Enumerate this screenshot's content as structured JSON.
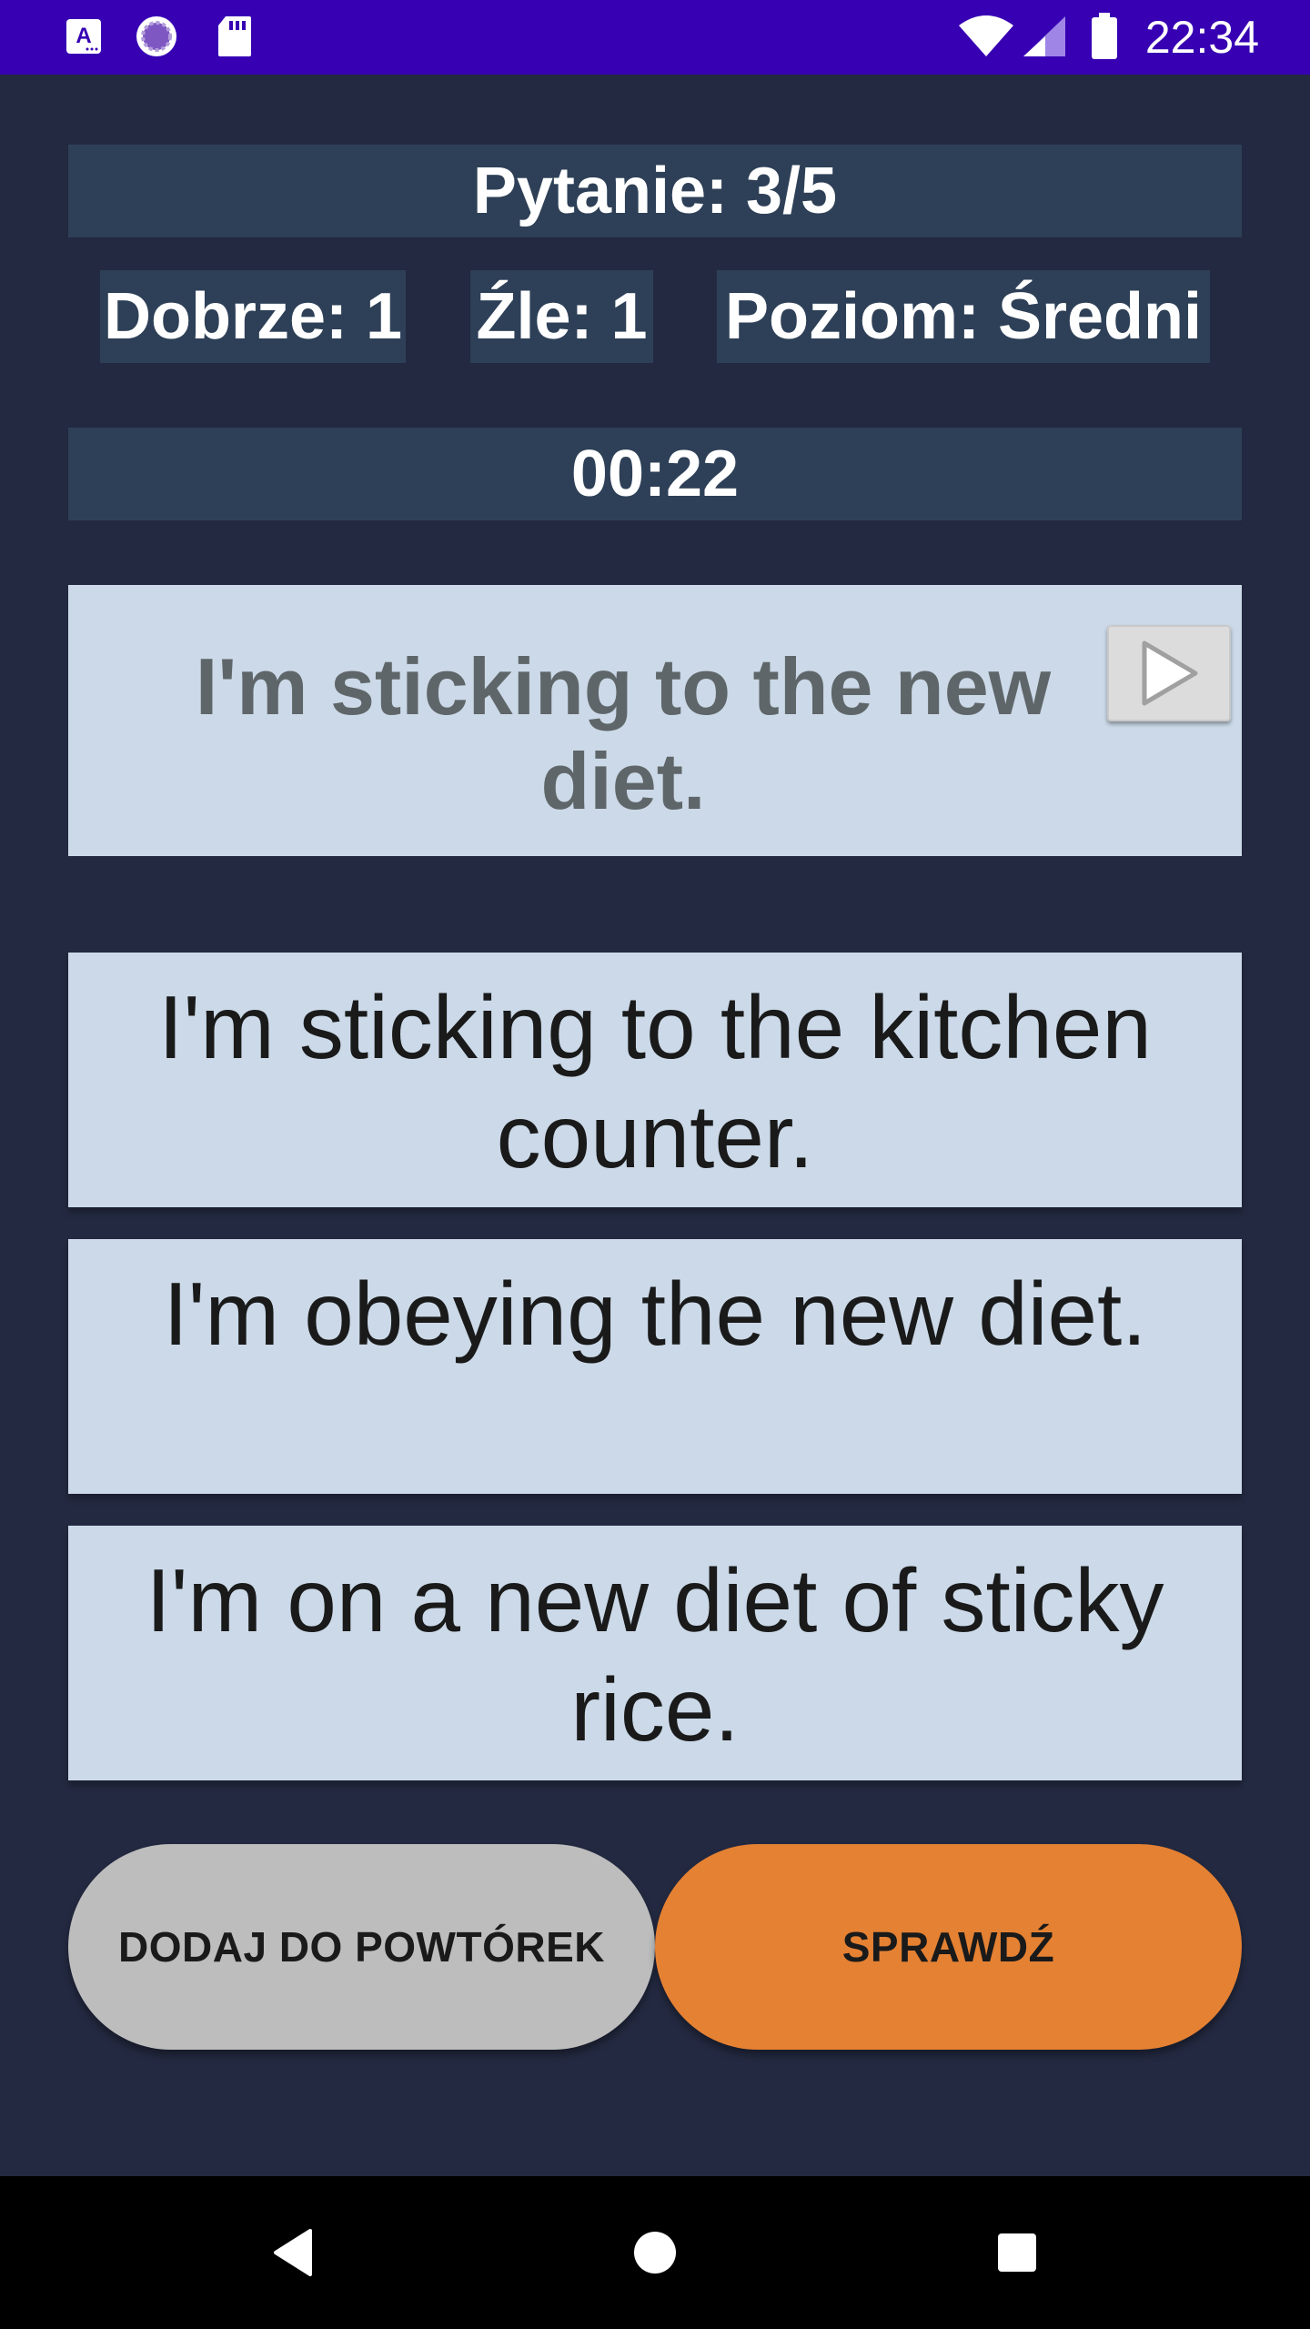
{
  "status_bar": {
    "time": "22:34",
    "icons": [
      "font-icon",
      "sync-icon",
      "sd-card-icon",
      "wifi-icon",
      "signal-icon",
      "battery-icon"
    ]
  },
  "stats": {
    "question": "Pytanie: 3/5",
    "correct": "Dobrze: 1",
    "wrong": "Źle: 1",
    "level": "Poziom: Średni",
    "timer": "00:22"
  },
  "question_card": {
    "text": "I'm sticking to the new diet.",
    "play_icon": "play-icon"
  },
  "answers": [
    "I'm sticking to the kitchen counter.",
    "I'm obeying the new diet.",
    "I'm on a new diet of sticky rice."
  ],
  "buttons": {
    "add_to_review": "DODAJ DO POWTÓREK",
    "check": "SPRAWDŹ"
  },
  "colors": {
    "background": "#232940",
    "status_bar": "#3700b3",
    "stat_box": "#2e4057",
    "card": "#cbd9e8",
    "add_button": "#bdbdbd",
    "check_button": "#e58133"
  },
  "nav": [
    "back-icon",
    "home-icon",
    "recents-icon"
  ]
}
